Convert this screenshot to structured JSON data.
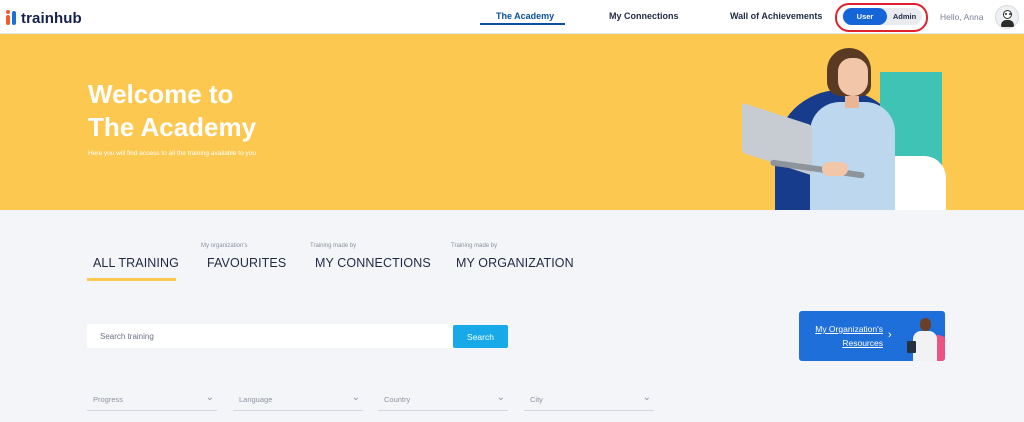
{
  "brand": {
    "logo_text": "trainhub",
    "accent": "#1e6fd9",
    "hero_bg": "#fdc84f",
    "red_highlight": "#e0202c"
  },
  "nav": {
    "items": [
      {
        "label": "The Academy",
        "active": true
      },
      {
        "label": "My Connections",
        "active": false
      },
      {
        "label": "Wall of Achievements",
        "active": false
      }
    ]
  },
  "role_toggle": {
    "user_label": "User",
    "admin_label": "Admin",
    "selected": "User"
  },
  "greeting": "Hello, Anna",
  "hero": {
    "title": "Welcome to\nThe Academy",
    "subtitle": "Here you will find access to all the training available to you"
  },
  "tabs": [
    {
      "pre": "",
      "label": "ALL TRAINING",
      "active": true
    },
    {
      "pre": "My organization's",
      "label": "FAVOURITES",
      "active": false
    },
    {
      "pre": "Training made by",
      "label": "MY CONNECTIONS",
      "active": false
    },
    {
      "pre": "Training made by",
      "label": "MY ORGANIZATION",
      "active": false
    }
  ],
  "search": {
    "placeholder": "Search training",
    "value": "",
    "button_label": "Search"
  },
  "resources_card": {
    "line1": "My Organization's",
    "line2": "Resources",
    "chevron": "›"
  },
  "filters": [
    {
      "label": "Progress",
      "icon": "chevron-down-icon"
    },
    {
      "label": "Language",
      "icon": "chevron-down-icon"
    },
    {
      "label": "Country",
      "icon": "chevron-down-icon"
    },
    {
      "label": "City",
      "icon": "chevron-down-icon"
    }
  ]
}
